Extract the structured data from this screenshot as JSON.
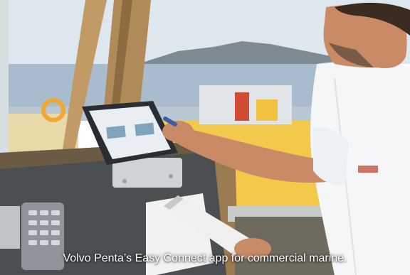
{
  "caption": "Volvo Penta’s Easy Connect app for commercial marine.",
  "colors": {
    "sky": "#dfe7ee",
    "water": "#a9bccd",
    "hills": "#7e8a92",
    "window_frame": "#b08a58",
    "deck_yellow": "#f2c94a",
    "console": "#4b4f52",
    "shirt": "#f4f6f7",
    "skin": "#c98b66",
    "tablet": "#2a2e33",
    "tablet_screen": "#e9eef2"
  }
}
